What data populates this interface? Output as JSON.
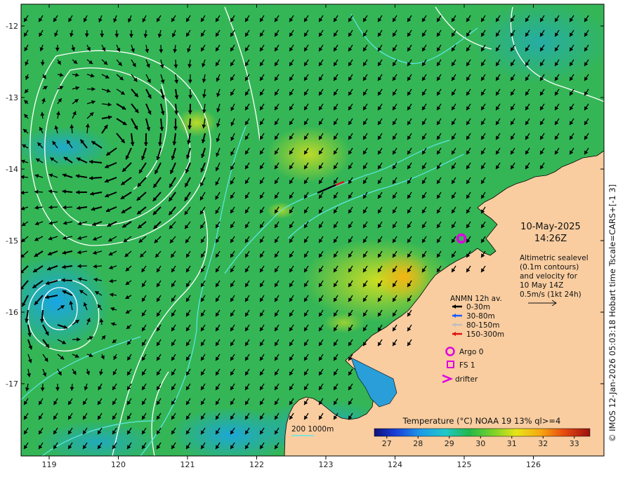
{
  "timestamp": {
    "date": "10-May-2025",
    "time": "14:26Z"
  },
  "description_lines": [
    "Altimetric sealevel",
    "(0.1m contours)",
    "and velocity for",
    "10 May 14Z",
    "0.5m/s (1kt 24h)"
  ],
  "legend": {
    "title": "ANMN 12h av.",
    "depths": [
      {
        "label": "0-30m",
        "color": "#000000"
      },
      {
        "label": "30-80m",
        "color": "#1f5cff"
      },
      {
        "label": "80-150m",
        "color": "#bfbfbf"
      },
      {
        "label": "150-300m",
        "color": "#e01010"
      }
    ],
    "markers": [
      {
        "label": "Argo 0",
        "symbol": "circle",
        "color": "#e000e0"
      },
      {
        "label": "FS 1",
        "symbol": "square",
        "color": "#e000e0"
      },
      {
        "label": "drifter",
        "symbol": "chevron",
        "color": "#e000e0"
      }
    ]
  },
  "bathymetry_label": "200  1000m",
  "colorbar": {
    "title": "Temperature (°C) NOAA 19 13% ql>=4",
    "ticks": [
      "27",
      "28",
      "29",
      "30",
      "31",
      "32",
      "33"
    ],
    "range": [
      26.6,
      33.5
    ]
  },
  "axes": {
    "lon_ticks": [
      "119",
      "120",
      "121",
      "122",
      "123",
      "124",
      "125",
      "126"
    ],
    "lat_ticks": [
      "-12",
      "-13",
      "-14",
      "-15",
      "-16",
      "-17"
    ]
  },
  "credit": "© IMOS 12-Jan-2026 05:03:18 Hobart time Tscale=CARS+[-1 3]",
  "colors": {
    "land": "#f9cda0",
    "sea_base": "#33b856",
    "contour": "#ffffff",
    "isobath": "#5fe8e8"
  }
}
